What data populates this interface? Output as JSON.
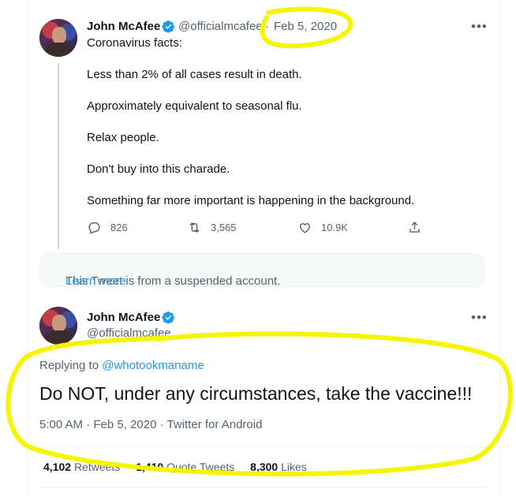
{
  "tweet1": {
    "name": "John McAfee",
    "handle": "@officialmcafee",
    "separator": "·",
    "date": "Feb 5, 2020",
    "more": "•••",
    "lines": [
      "Coronavirus facts:",
      "Less than 2% of all cases result in death.",
      "Approximately equivalent to seasonal flu.",
      "Relax people.",
      "Don't buy into this charade.",
      "Something far more important is happening in the background."
    ],
    "actions": {
      "replies": "826",
      "retweets": "3,565",
      "likes": "10.9K"
    }
  },
  "suspended_notice": {
    "text": "This Tweet is from a suspended account.",
    "link": "Learn more"
  },
  "tweet2": {
    "name": "John McAfee",
    "handle": "@officialmcafee",
    "more": "•••",
    "replying_label": "Replying to",
    "replying_to": "@whotookmaname",
    "text": "Do NOT, under any circumstances, take the vaccine!!!",
    "time": "5:00 AM",
    "date": "Feb 5, 2020",
    "source": "Twitter for Android",
    "sep": "·",
    "stats": {
      "retweets_count": "4,102",
      "retweets_label": "Retweets",
      "quotes_count": "1,410",
      "quotes_label": "Quote Tweets",
      "likes_count": "8,300",
      "likes_label": "Likes"
    }
  },
  "colors": {
    "accent": "#1d9bf0",
    "highlight": "#f5f500",
    "muted": "#536471"
  }
}
